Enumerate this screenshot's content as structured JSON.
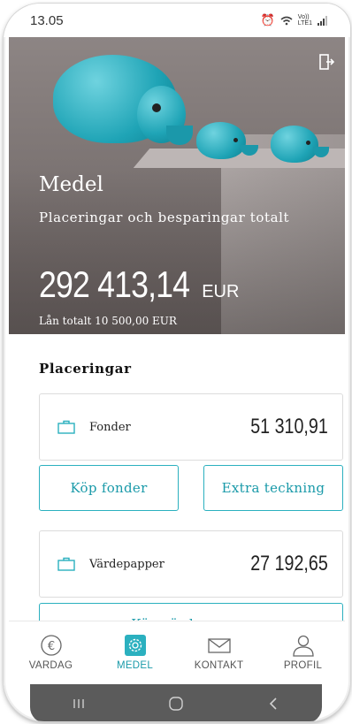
{
  "status_bar": {
    "time": "13.05",
    "network_label": "Vo))\nLTE1"
  },
  "hero": {
    "title": "Medel",
    "subtitle": "Placeringar och besparingar totalt",
    "total_amount": "292 413,14",
    "currency": "EUR",
    "loan_text": "Lån totalt 10 500,00 EUR"
  },
  "placements": {
    "section_title": "Placeringar",
    "holdings": [
      {
        "label": "Fonder",
        "value": "51 310,91"
      },
      {
        "label": "Värdepapper",
        "value": "27 192,65"
      }
    ],
    "buttons": {
      "buy_funds": "Köp fonder",
      "extra_subscription": "Extra teckning",
      "buy_securities": "Köp värdepapper"
    }
  },
  "tabs": [
    {
      "label": "VARDAG",
      "icon": "euro-coin-icon"
    },
    {
      "label": "MEDEL",
      "icon": "savings-gear-icon",
      "active": true
    },
    {
      "label": "KONTAKT",
      "icon": "envelope-icon"
    },
    {
      "label": "PROFIL",
      "icon": "person-icon"
    }
  ],
  "colors": {
    "accent": "#1a9aa9",
    "hero_bg": "#7c7473",
    "elephant": "#1fa4b6"
  }
}
